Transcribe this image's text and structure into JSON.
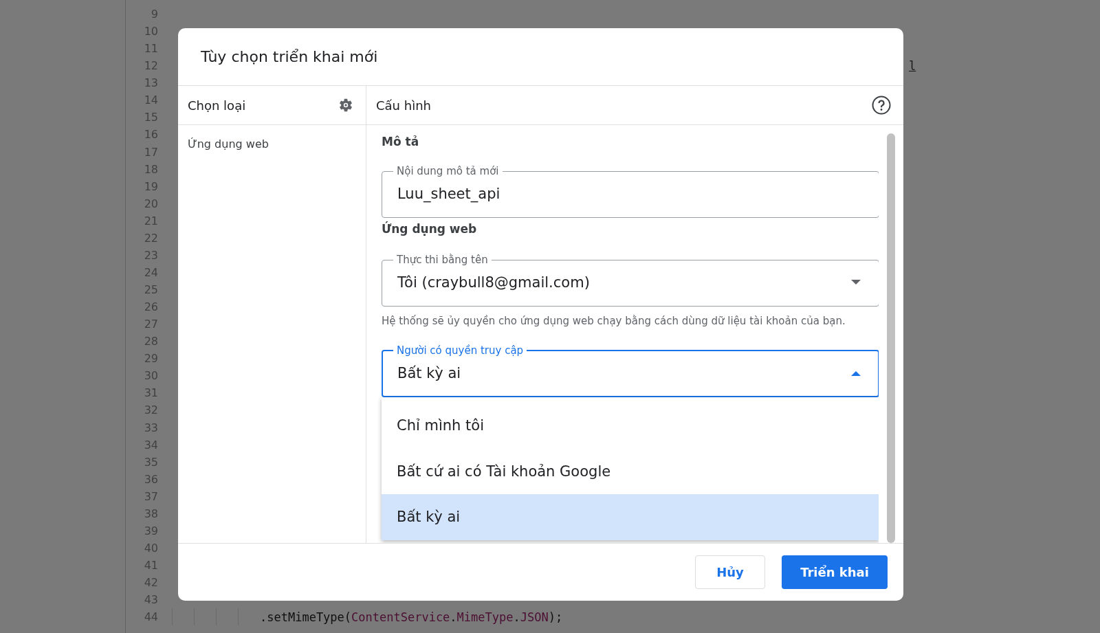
{
  "editor": {
    "lines": [
      {
        "number": "9"
      },
      {
        "number": "10"
      },
      {
        "number": "11"
      },
      {
        "number": "12",
        "code": [
          {
            "kind": "fragment",
            "text": "l"
          }
        ]
      },
      {
        "number": "13"
      },
      {
        "number": "14"
      },
      {
        "number": "15"
      },
      {
        "number": "16"
      },
      {
        "number": "17"
      },
      {
        "number": "18"
      },
      {
        "number": "19"
      },
      {
        "number": "20"
      },
      {
        "number": "21"
      },
      {
        "number": "22"
      },
      {
        "number": "23"
      },
      {
        "number": "24"
      },
      {
        "number": "25"
      },
      {
        "number": "26"
      },
      {
        "number": "27"
      },
      {
        "number": "28"
      },
      {
        "number": "29"
      },
      {
        "number": "30"
      },
      {
        "number": "31"
      },
      {
        "number": "32"
      },
      {
        "number": "33"
      },
      {
        "number": "34"
      },
      {
        "number": "35"
      },
      {
        "number": "36"
      },
      {
        "number": "37"
      },
      {
        "number": "38"
      },
      {
        "number": "39"
      },
      {
        "number": "40"
      },
      {
        "number": "41"
      },
      {
        "number": "42"
      },
      {
        "number": "43"
      },
      {
        "number": "44",
        "code": [
          {
            "kind": "plain",
            "text": ".setMimeType("
          },
          {
            "kind": "class",
            "text": "ContentService"
          },
          {
            "kind": "plain",
            "text": "."
          },
          {
            "kind": "class",
            "text": "MimeType"
          },
          {
            "kind": "plain",
            "text": "."
          },
          {
            "kind": "class",
            "text": "JSON"
          },
          {
            "kind": "plain",
            "text": ");"
          }
        ]
      }
    ]
  },
  "dialog": {
    "title": "Tùy chọn triển khai mới",
    "type_panel": {
      "heading": "Chọn loại",
      "types": [
        {
          "label": "Ứng dụng web",
          "selected": false
        }
      ]
    },
    "config_panel": {
      "heading": "Cấu hình",
      "description_heading": "Mô tả",
      "description_field": {
        "label": "Nội dung mô tả mới",
        "value": "Luu_sheet_api"
      },
      "web_app_heading": "Ứng dụng web",
      "execute_as": {
        "label": "Thực thi bằng tên",
        "value": "Tôi (craybull8@gmail.com)",
        "expanded": false
      },
      "execute_as_hint": "Hệ thống sẽ ủy quyền cho ứng dụng web chạy bằng cách dùng dữ liệu tài khoản của bạn.",
      "access": {
        "label": "Người có quyền truy cập",
        "value": "Bất kỳ ai",
        "expanded": true,
        "options": [
          {
            "label": "Chỉ mình tôi",
            "selected": false
          },
          {
            "label": "Bất cứ ai có Tài khoản Google",
            "selected": false
          },
          {
            "label": "Bất kỳ ai",
            "selected": true
          }
        ]
      }
    },
    "buttons": [
      {
        "label": "Hủy",
        "kind": "secondary"
      },
      {
        "label": "Triển khai",
        "kind": "primary"
      }
    ]
  }
}
